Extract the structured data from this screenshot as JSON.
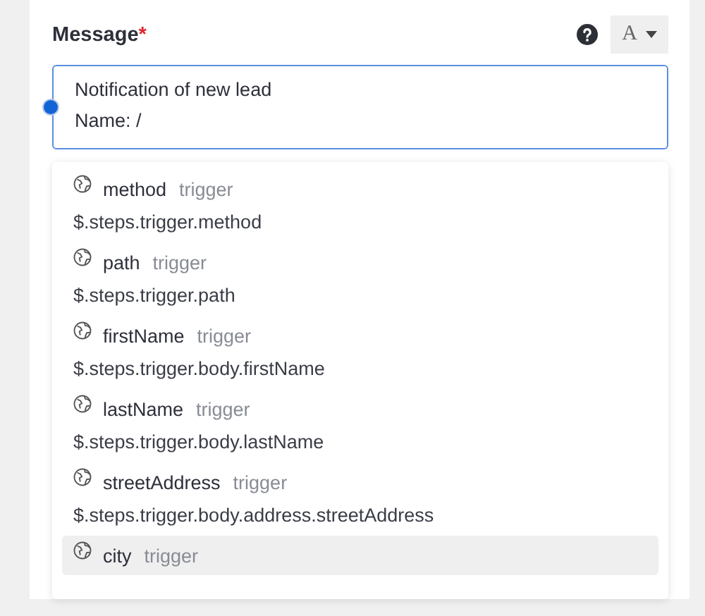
{
  "field": {
    "label": "Message",
    "required_mark": "*",
    "format_button": "A",
    "value": "Notification of new lead\nName: /",
    "focused": true
  },
  "suggestions": [
    {
      "name": "method",
      "source": "trigger",
      "path": "$.steps.trigger.method",
      "selected": false
    },
    {
      "name": "path",
      "source": "trigger",
      "path": "$.steps.trigger.path",
      "selected": false
    },
    {
      "name": "firstName",
      "source": "trigger",
      "path": "$.steps.trigger.body.firstName",
      "selected": false
    },
    {
      "name": "lastName",
      "source": "trigger",
      "path": "$.steps.trigger.body.lastName",
      "selected": false
    },
    {
      "name": "streetAddress",
      "source": "trigger",
      "path": "$.steps.trigger.body.address.streetAddress",
      "selected": false
    },
    {
      "name": "city",
      "source": "trigger",
      "selected": true
    }
  ]
}
